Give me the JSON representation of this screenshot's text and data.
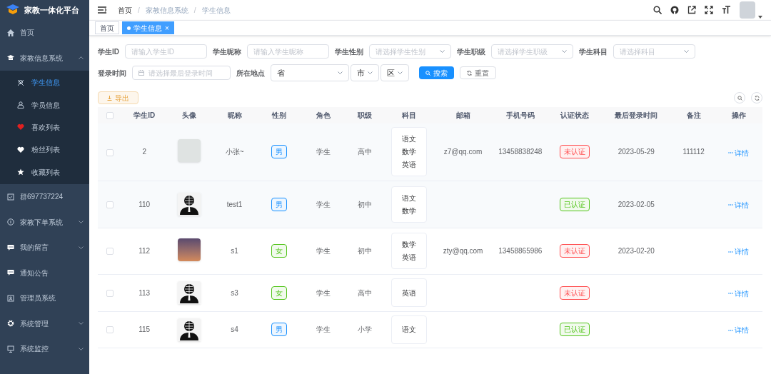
{
  "app": {
    "title": "家教一体化平台"
  },
  "sidebar": {
    "items": [
      {
        "label": "首页",
        "has_children": false
      },
      {
        "label": "家教信息系统",
        "expanded": true,
        "has_children": true,
        "children": [
          {
            "label": "学生信息",
            "selected": true
          },
          {
            "label": "学员信息",
            "selected": false
          },
          {
            "label": "喜欢列表",
            "selected": false
          },
          {
            "label": "粉丝列表",
            "selected": false
          },
          {
            "label": "收藏列表",
            "selected": false
          }
        ]
      },
      {
        "label": "群697737224",
        "has_children": false
      },
      {
        "label": "家教下单系统",
        "expanded": false,
        "has_children": true
      },
      {
        "label": "我的留言",
        "expanded": false,
        "has_children": true
      },
      {
        "label": "通知公告",
        "has_children": false
      },
      {
        "label": "管理员系统",
        "has_children": false
      },
      {
        "label": "系统管理",
        "expanded": false,
        "has_children": true
      },
      {
        "label": "系统监控",
        "expanded": false,
        "has_children": true
      }
    ]
  },
  "breadcrumb": [
    {
      "kind": "item",
      "text": "首页"
    },
    {
      "kind": "separator",
      "text": "/"
    },
    {
      "kind": "item",
      "text": "家教信息系统"
    },
    {
      "kind": "separator",
      "text": "/"
    },
    {
      "kind": "item",
      "text": "学生信息"
    }
  ],
  "tabs": [
    {
      "label": "首页",
      "selected": false,
      "closable": false
    },
    {
      "label": "学生信息",
      "selected": true,
      "closable": true,
      "close": "×"
    }
  ],
  "filters": {
    "rows": [
      [
        {
          "label": "学生ID",
          "kind": "input",
          "placeholder": "请输入学生ID"
        },
        {
          "label": "学生昵称",
          "kind": "input",
          "placeholder": "请输入学生昵称"
        },
        {
          "label": "学生性别",
          "kind": "select",
          "placeholder": "请选择学生性别"
        },
        {
          "label": "学生职级",
          "kind": "select",
          "placeholder": "请选择学生职级"
        },
        {
          "label": "学生科目",
          "kind": "select",
          "placeholder": "请选择科目"
        }
      ],
      [
        {
          "label": "登录时间",
          "kind": "date",
          "placeholder": "请选择最后登录时间"
        },
        {
          "label": "所在地点",
          "kind": "region",
          "selects": [
            "省",
            "市",
            "区"
          ]
        }
      ]
    ],
    "search_button": "搜索",
    "reset_button": "重置"
  },
  "export_button": "导出",
  "table": {
    "select_all_checked": false,
    "columns": [
      "学生ID",
      "头像",
      "昵称",
      "性别",
      "角色",
      "职级",
      "科目",
      "邮箱",
      "手机号码",
      "认证状态",
      "最后登录时间",
      "备注",
      "操作"
    ],
    "rows": [
      {
        "checked": false,
        "kind": "photo",
        "id": "2",
        "nickname": "小张~",
        "gender": {
          "text": "男",
          "color": "#1890ff"
        },
        "role": "学生",
        "level": "高中",
        "subjects": [
          "语文",
          "数学",
          "英语"
        ],
        "email": "z7@qq.com",
        "phone": "13458838248",
        "status": {
          "text": "未认证",
          "color": "#ff4d4f"
        },
        "last_login": "2023-05-29",
        "remark": "111112",
        "action": "详情"
      },
      {
        "checked": false,
        "kind": "silhouette",
        "id": "110",
        "nickname": "test1",
        "gender": {
          "text": "男",
          "color": "#1890ff"
        },
        "role": "学生",
        "level": "初中",
        "subjects": [
          "语文",
          "数学"
        ],
        "status": {
          "text": "已认证",
          "color": "#52c41a"
        },
        "last_login": "2023-02-05",
        "action": "详情"
      },
      {
        "checked": false,
        "kind": "landscape",
        "id": "112",
        "nickname": "s1",
        "gender": {
          "text": "女",
          "color": "#52c41a"
        },
        "role": "学生",
        "level": "初中",
        "subjects": [
          "数学",
          "英语"
        ],
        "email": "zty@qq.com",
        "phone": "13458865986",
        "status": {
          "text": "未认证",
          "color": "#ff4d4f"
        },
        "last_login": "2023-02-20",
        "action": "详情"
      },
      {
        "checked": false,
        "kind": "silhouette",
        "id": "113",
        "nickname": "s3",
        "gender": {
          "text": "女",
          "color": "#52c41a"
        },
        "role": "学生",
        "level": "高中",
        "subjects": [
          "英语"
        ],
        "status": {
          "text": "未认证",
          "color": "#ff4d4f"
        },
        "action": "详情"
      },
      {
        "checked": false,
        "kind": "silhouette",
        "id": "115",
        "nickname": "s4",
        "gender": {
          "text": "男",
          "color": "#1890ff"
        },
        "role": "学生",
        "level": "小学",
        "subjects": [
          "语文"
        ],
        "status": {
          "text": "已认证",
          "color": "#52c41a"
        },
        "action": "详情"
      }
    ]
  }
}
